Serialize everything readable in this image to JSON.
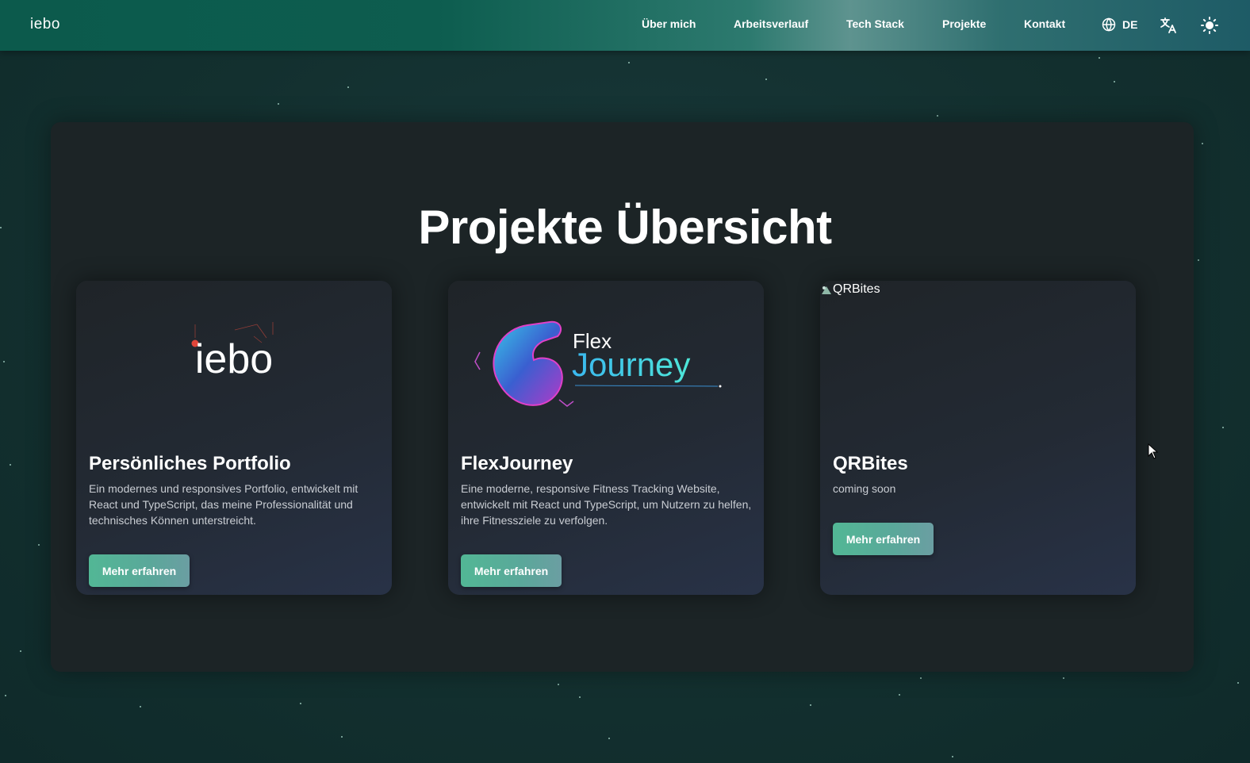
{
  "nav": {
    "logo": "iebo",
    "links": [
      "Über mich",
      "Arbeitsverlauf",
      "Tech Stack",
      "Projekte",
      "Kontakt"
    ],
    "language": "DE",
    "icons": [
      "globe-icon",
      "translate-icon",
      "sun-icon"
    ]
  },
  "main": {
    "title": "Projekte Übersicht",
    "projects": [
      {
        "logo_text": "iebo",
        "title": "Persönliches Portfolio",
        "description": "Ein modernes und responsives Portfolio, entwickelt mit React und TypeScript, das meine Professionalität und technisches Können unterstreicht.",
        "button": "Mehr erfahren"
      },
      {
        "logo_line1": "Flex",
        "logo_line2": "Journey",
        "title": "FlexJourney",
        "description": "Eine moderne, responsive Fitness Tracking Website, entwickelt mit React und TypeScript, um Nutzern zu helfen, ihre Fitnessziele zu verfolgen.",
        "button": "Mehr erfahren"
      },
      {
        "image_alt": "QRBites",
        "title": "QRBites",
        "description": "coming soon",
        "button": "Mehr erfahren"
      }
    ]
  },
  "colors": {
    "accent": "#52b795",
    "nav_start": "#0c5a4c",
    "background": "#13302f",
    "panel": "#1c2426"
  }
}
